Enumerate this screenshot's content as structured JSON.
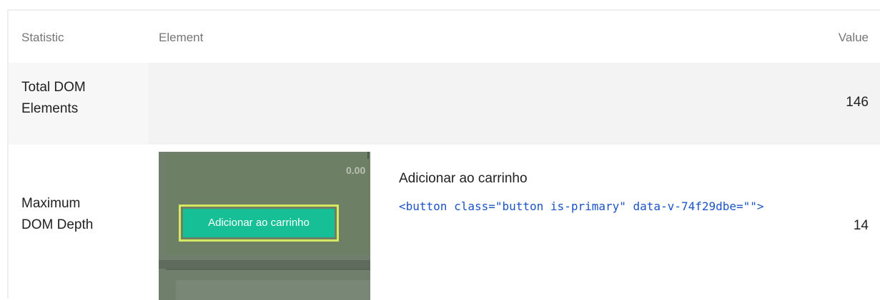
{
  "table": {
    "headers": {
      "statistic": "Statistic",
      "element": "Element",
      "value": "Value"
    },
    "rows": [
      {
        "statistic_line1": "Total DOM",
        "statistic_line2": "Elements",
        "value": "146"
      },
      {
        "statistic_line1": "Maximum",
        "statistic_line2": "DOM Depth",
        "value": "14",
        "element": {
          "thumbnail": {
            "price_fragment": "0.00",
            "button_label": "Adicionar ao carrinho"
          },
          "node_label": "Adicionar ao carrinho",
          "node_snippet": "<button class=\"button is-primary\" data-v-74f29dbe=\"\">"
        }
      }
    ]
  },
  "colors": {
    "snippet": "#1a53c6",
    "header_text": "#757575",
    "highlight": "#d6e85f",
    "primary_button": "#17bf96"
  }
}
